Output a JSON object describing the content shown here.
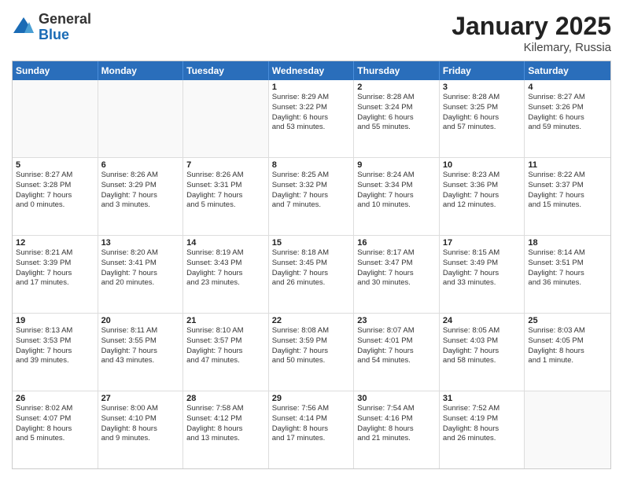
{
  "logo": {
    "general": "General",
    "blue": "Blue"
  },
  "header": {
    "month": "January 2025",
    "location": "Kilemary, Russia"
  },
  "weekdays": [
    "Sunday",
    "Monday",
    "Tuesday",
    "Wednesday",
    "Thursday",
    "Friday",
    "Saturday"
  ],
  "rows": [
    [
      {
        "day": "",
        "info": ""
      },
      {
        "day": "",
        "info": ""
      },
      {
        "day": "",
        "info": ""
      },
      {
        "day": "1",
        "info": "Sunrise: 8:29 AM\nSunset: 3:22 PM\nDaylight: 6 hours\nand 53 minutes."
      },
      {
        "day": "2",
        "info": "Sunrise: 8:28 AM\nSunset: 3:24 PM\nDaylight: 6 hours\nand 55 minutes."
      },
      {
        "day": "3",
        "info": "Sunrise: 8:28 AM\nSunset: 3:25 PM\nDaylight: 6 hours\nand 57 minutes."
      },
      {
        "day": "4",
        "info": "Sunrise: 8:27 AM\nSunset: 3:26 PM\nDaylight: 6 hours\nand 59 minutes."
      }
    ],
    [
      {
        "day": "5",
        "info": "Sunrise: 8:27 AM\nSunset: 3:28 PM\nDaylight: 7 hours\nand 0 minutes."
      },
      {
        "day": "6",
        "info": "Sunrise: 8:26 AM\nSunset: 3:29 PM\nDaylight: 7 hours\nand 3 minutes."
      },
      {
        "day": "7",
        "info": "Sunrise: 8:26 AM\nSunset: 3:31 PM\nDaylight: 7 hours\nand 5 minutes."
      },
      {
        "day": "8",
        "info": "Sunrise: 8:25 AM\nSunset: 3:32 PM\nDaylight: 7 hours\nand 7 minutes."
      },
      {
        "day": "9",
        "info": "Sunrise: 8:24 AM\nSunset: 3:34 PM\nDaylight: 7 hours\nand 10 minutes."
      },
      {
        "day": "10",
        "info": "Sunrise: 8:23 AM\nSunset: 3:36 PM\nDaylight: 7 hours\nand 12 minutes."
      },
      {
        "day": "11",
        "info": "Sunrise: 8:22 AM\nSunset: 3:37 PM\nDaylight: 7 hours\nand 15 minutes."
      }
    ],
    [
      {
        "day": "12",
        "info": "Sunrise: 8:21 AM\nSunset: 3:39 PM\nDaylight: 7 hours\nand 17 minutes."
      },
      {
        "day": "13",
        "info": "Sunrise: 8:20 AM\nSunset: 3:41 PM\nDaylight: 7 hours\nand 20 minutes."
      },
      {
        "day": "14",
        "info": "Sunrise: 8:19 AM\nSunset: 3:43 PM\nDaylight: 7 hours\nand 23 minutes."
      },
      {
        "day": "15",
        "info": "Sunrise: 8:18 AM\nSunset: 3:45 PM\nDaylight: 7 hours\nand 26 minutes."
      },
      {
        "day": "16",
        "info": "Sunrise: 8:17 AM\nSunset: 3:47 PM\nDaylight: 7 hours\nand 30 minutes."
      },
      {
        "day": "17",
        "info": "Sunrise: 8:15 AM\nSunset: 3:49 PM\nDaylight: 7 hours\nand 33 minutes."
      },
      {
        "day": "18",
        "info": "Sunrise: 8:14 AM\nSunset: 3:51 PM\nDaylight: 7 hours\nand 36 minutes."
      }
    ],
    [
      {
        "day": "19",
        "info": "Sunrise: 8:13 AM\nSunset: 3:53 PM\nDaylight: 7 hours\nand 39 minutes."
      },
      {
        "day": "20",
        "info": "Sunrise: 8:11 AM\nSunset: 3:55 PM\nDaylight: 7 hours\nand 43 minutes."
      },
      {
        "day": "21",
        "info": "Sunrise: 8:10 AM\nSunset: 3:57 PM\nDaylight: 7 hours\nand 47 minutes."
      },
      {
        "day": "22",
        "info": "Sunrise: 8:08 AM\nSunset: 3:59 PM\nDaylight: 7 hours\nand 50 minutes."
      },
      {
        "day": "23",
        "info": "Sunrise: 8:07 AM\nSunset: 4:01 PM\nDaylight: 7 hours\nand 54 minutes."
      },
      {
        "day": "24",
        "info": "Sunrise: 8:05 AM\nSunset: 4:03 PM\nDaylight: 7 hours\nand 58 minutes."
      },
      {
        "day": "25",
        "info": "Sunrise: 8:03 AM\nSunset: 4:05 PM\nDaylight: 8 hours\nand 1 minute."
      }
    ],
    [
      {
        "day": "26",
        "info": "Sunrise: 8:02 AM\nSunset: 4:07 PM\nDaylight: 8 hours\nand 5 minutes."
      },
      {
        "day": "27",
        "info": "Sunrise: 8:00 AM\nSunset: 4:10 PM\nDaylight: 8 hours\nand 9 minutes."
      },
      {
        "day": "28",
        "info": "Sunrise: 7:58 AM\nSunset: 4:12 PM\nDaylight: 8 hours\nand 13 minutes."
      },
      {
        "day": "29",
        "info": "Sunrise: 7:56 AM\nSunset: 4:14 PM\nDaylight: 8 hours\nand 17 minutes."
      },
      {
        "day": "30",
        "info": "Sunrise: 7:54 AM\nSunset: 4:16 PM\nDaylight: 8 hours\nand 21 minutes."
      },
      {
        "day": "31",
        "info": "Sunrise: 7:52 AM\nSunset: 4:19 PM\nDaylight: 8 hours\nand 26 minutes."
      },
      {
        "day": "",
        "info": ""
      }
    ]
  ]
}
